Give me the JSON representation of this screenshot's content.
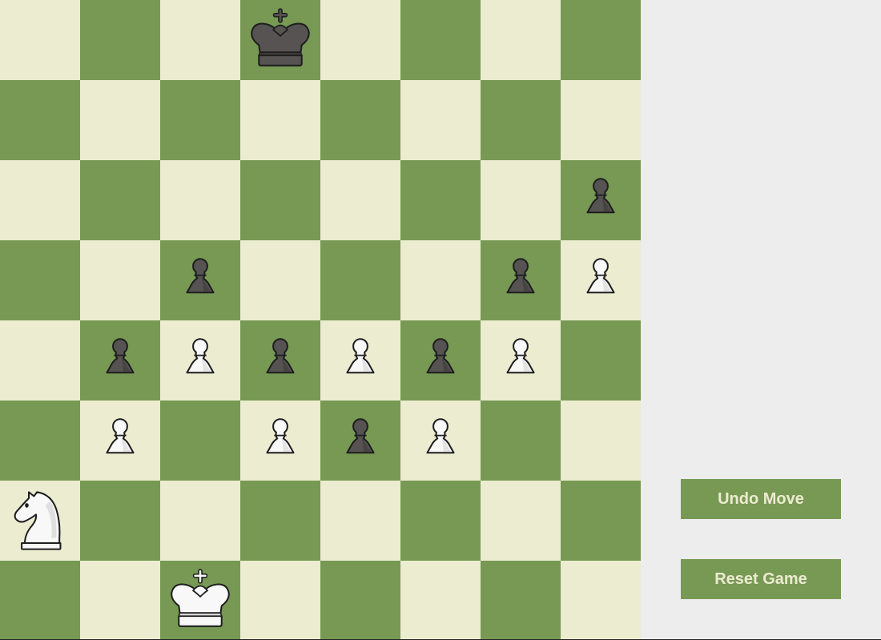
{
  "colors": {
    "light_square": "#ebecd0",
    "dark_square": "#779954",
    "panel_background": "#ededed",
    "button_background": "#779954",
    "button_text": "#ecebd0",
    "white_piece": "#f8f8f8",
    "black_piece": "#565352"
  },
  "board": {
    "ranks": [
      [
        "",
        "",
        "",
        "bK",
        "",
        "",
        "",
        ""
      ],
      [
        "",
        "",
        "",
        "",
        "",
        "",
        "",
        ""
      ],
      [
        "",
        "",
        "",
        "",
        "",
        "",
        "",
        "bP"
      ],
      [
        "",
        "",
        "bP",
        "",
        "",
        "",
        "bP",
        "wP"
      ],
      [
        "",
        "bP",
        "wP",
        "bP",
        "wP",
        "bP",
        "wP",
        ""
      ],
      [
        "",
        "wP",
        "",
        "wP",
        "bP",
        "wP",
        "",
        ""
      ],
      [
        "wN",
        "",
        "",
        "",
        "",
        "",
        "",
        ""
      ],
      [
        "",
        "",
        "wK",
        "",
        "",
        "",
        "",
        ""
      ]
    ]
  },
  "piece_icons": {
    "wK": "white-king-icon",
    "bK": "black-king-icon",
    "wP": "white-pawn-icon",
    "bP": "black-pawn-icon",
    "wN": "white-knight-icon"
  },
  "controls": {
    "undo_label": "Undo Move",
    "reset_label": "Reset Game"
  }
}
